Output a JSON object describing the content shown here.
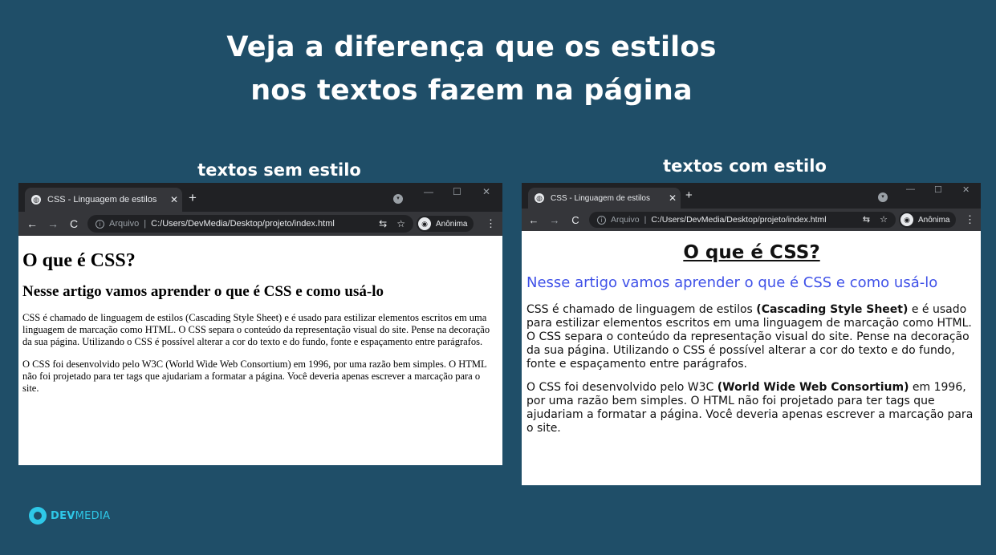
{
  "headline": {
    "line1": "Veja a diferença que os estilos",
    "line2": "nos textos fazem na página"
  },
  "captions": {
    "left": "textos sem estilo",
    "right": "textos com estilo"
  },
  "browser": {
    "tab_title": "CSS - Linguagem de estilos",
    "tab_close": "✕",
    "new_tab": "+",
    "back": "←",
    "forward": "→",
    "reload": "C",
    "arquivo": "Arquivo",
    "separator": "|",
    "url": "C:/Users/DevMedia/Desktop/projeto/index.html",
    "translate": "⇆",
    "star": "☆",
    "profile_label": "Anônima",
    "menu": "⋮",
    "minimize": "—",
    "maximize": "☐",
    "close": "✕",
    "icons": [
      "globe-icon",
      "back-icon",
      "forward-icon",
      "reload-icon",
      "info-icon",
      "translate-icon",
      "star-icon",
      "incognito-icon",
      "menu-icon"
    ]
  },
  "page": {
    "h1": "O que é CSS?",
    "h2": "Nesse artigo vamos aprender o que é CSS e como usá-lo",
    "p1_plain": "CSS é chamado de linguagem de estilos (Cascading Style Sheet) e é usado para estilizar elementos escritos em uma linguagem de marcação como HTML. O CSS separa o conteúdo da representação visual do site. Pense na decoração da sua página. Utilizando o CSS é possível alterar a cor do texto e do fundo, fonte e espaçamento entre parágrafos.",
    "p2_plain": "O CSS foi desenvolvido pelo W3C (World Wide Web Consortium) em 1996, por uma razão bem simples. O HTML não foi projetado para ter tags que ajudariam a formatar a página. Você deveria apenas escrever a marcação para o site.",
    "p1_before": "CSS é chamado de linguagem de estilos ",
    "p1_bold": "(Cascading Style Sheet)",
    "p1_after": " e é usado para estilizar elementos escritos em uma linguagem de marcação como HTML. O CSS separa o conteúdo da representação visual do site. Pense na decoração da sua página. Utilizando o CSS é possível alterar a cor do texto e do fundo, fonte e espaçamento entre parágrafos.",
    "p2_before": "O CSS foi desenvolvido pelo W3C ",
    "p2_bold": "(World Wide Web Consortium)",
    "p2_after": " em 1996, por uma razão bem simples. O HTML não foi projetado para ter tags que ajudariam a formatar a página. Você deveria apenas escrever a marcação para o site."
  },
  "logo": {
    "dev": "DEV",
    "media": "MEDIA"
  },
  "colors": {
    "background": "#1f4e68",
    "h2_styled": "#3f51e8",
    "logo": "#2ec8e8"
  }
}
